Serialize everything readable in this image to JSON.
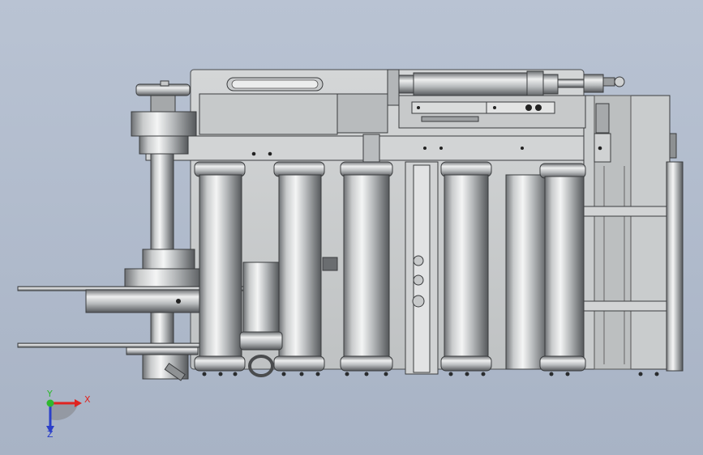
{
  "viewport": {
    "background_top": "#b9c3d3",
    "background_bottom": "#a9b4c6"
  },
  "colors": {
    "metal_dark": "#5a5d60",
    "metal_mid": "#a9adb0",
    "metal_light": "#e4e6e6",
    "plate": "#c4c7c8",
    "plate_light": "#d6d8d8",
    "edge": "#3a3c3e"
  },
  "triad": {
    "x_label": "X",
    "y_label": "Y",
    "z_label": "Z",
    "x_color": "#e0231f",
    "y_color": "#2eb82e",
    "z_color": "#2b3fc9"
  }
}
